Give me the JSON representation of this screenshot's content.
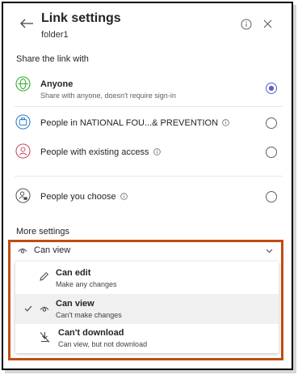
{
  "header": {
    "title": "Link settings",
    "subtitle": "folder1"
  },
  "share": {
    "label": "Share the link with",
    "options": [
      {
        "title": "Anyone",
        "desc": "Share with anyone, doesn't require sign-in",
        "selected": true,
        "icon": "globe-icon"
      },
      {
        "title": "People in NATIONAL FOU...& PREVENTION",
        "desc": "",
        "selected": false,
        "icon": "building-icon",
        "info": true
      },
      {
        "title": "People with existing access",
        "desc": "",
        "selected": false,
        "icon": "person-icon",
        "info": true
      },
      {
        "title": "People you choose",
        "desc": "",
        "selected": false,
        "icon": "person-lock-icon",
        "info": true
      }
    ]
  },
  "more": {
    "label": "More settings",
    "dropdown_value": "Can view",
    "menu": [
      {
        "title": "Can edit",
        "desc": "Make any changes",
        "selected": false,
        "icon": "pencil-icon"
      },
      {
        "title": "Can view",
        "desc": "Can't make changes",
        "selected": true,
        "icon": "eye-icon"
      },
      {
        "title": "Can't download",
        "desc": "Can view, but not download",
        "selected": false,
        "icon": "no-download-icon"
      }
    ]
  },
  "colors": {
    "accent": "#5b5fc7",
    "highlight_border": "#c04d13",
    "globe": "#13a10e",
    "building": "#0f6cbd",
    "person": "#c4314b"
  }
}
